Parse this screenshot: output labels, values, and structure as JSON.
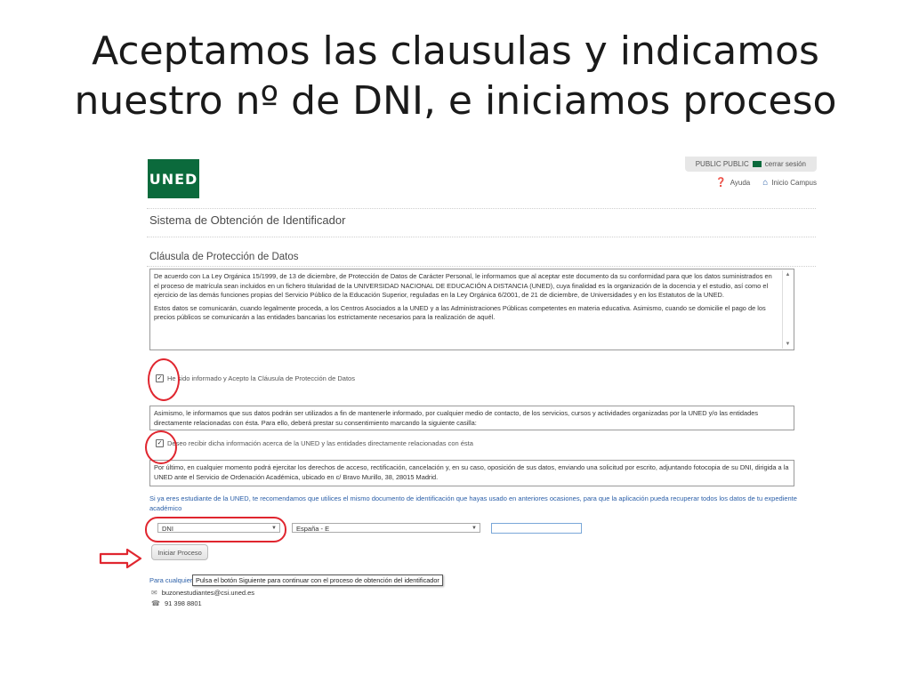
{
  "slide": {
    "title_line1": "Aceptamos las clausulas y indicamos",
    "title_line2": "nuestro nº de DNI, e iniciamos proceso"
  },
  "header": {
    "logo_text": "UNED",
    "user_label": "PUBLIC PUBLIC",
    "logout_label": "cerrar sesión",
    "help_label": "Ayuda",
    "home_label": "Inicio Campus"
  },
  "page": {
    "system_title": "Sistema de Obtención de Identificador",
    "clause_title": "Cláusula de Protección de Datos",
    "clause_p1": "De acuerdo con La Ley Orgánica 15/1999, de 13 de diciembre, de Protección de Datos de Carácter Personal, le informamos que al aceptar este documento da su conformidad para que los datos suministrados en el proceso de matrícula sean incluidos en un fichero titularidad de la UNIVERSIDAD NACIONAL DE EDUCACIÓN A DISTANCIA (UNED), cuya finalidad es la organización de la docencia y el estudio, así como el ejercicio de las demás funciones propias del Servicio Público de la Educación Superior, reguladas en la Ley Orgánica 6/2001, de 21 de diciembre, de Universidades y en los Estatutos de la UNED.",
    "clause_p2": "Estos datos se comunicarán, cuando legalmente proceda, a los Centros Asociados a la UNED y a las Administraciones Públicas competentes en materia educativa. Asimismo, cuando se domicilie el pago de los precios públicos se comunicarán a las entidades bancarias los estrictamente necesarios para la realización de aquél.",
    "check1_label": "He sido informado y Acepto la Cláusula de Protección de Datos",
    "info_box2": "Asimismo, le informamos que sus datos podrán ser utilizados a fin de mantenerle informado, por cualquier medio de contacto, de los servicios, cursos y actividades organizadas por la UNED y/o las entidades directamente relacionadas con ésta. Para ello, deberá prestar su consentimiento marcando la siguiente casilla:",
    "check2_label": "Deseo recibir dicha información acerca de la UNED y las entidades directamente relacionadas con ésta",
    "info_box3": "Por último, en cualquier momento podrá ejercitar los derechos de acceso, rectificación, cancelación y, en su caso, oposición de sus datos, enviando una solicitud por escrito, adjuntando fotocopia de su DNI, dirigida a la UNED ante el Servicio de Ordenación Académica, ubicado en c/ Bravo Murillo, 38, 28015 Madrid.",
    "student_note": "Si ya eres estudiante de la UNED, te recomendamos que utilices el mismo documento de identificación que hayas usado en anteriores ocasiones, para que la aplicación pueda recuperar todos los datos de tu expediente académico",
    "doc_type_value": "DNI",
    "country_value": "España - E",
    "doc_number_value": "",
    "start_button": "Iniciar Proceso",
    "contact_prefix": "Para cualquier",
    "tooltip": "Pulsa el botón Siguiente para continuar con el proceso de obtención del identificador",
    "contact_email": "buzonestudiantes@csi.uned.es",
    "contact_phone": "91 398 8801"
  },
  "colors": {
    "uned_green": "#0b6a3c",
    "link_blue": "#2b5fa8",
    "annotation_red": "#e0262f"
  }
}
